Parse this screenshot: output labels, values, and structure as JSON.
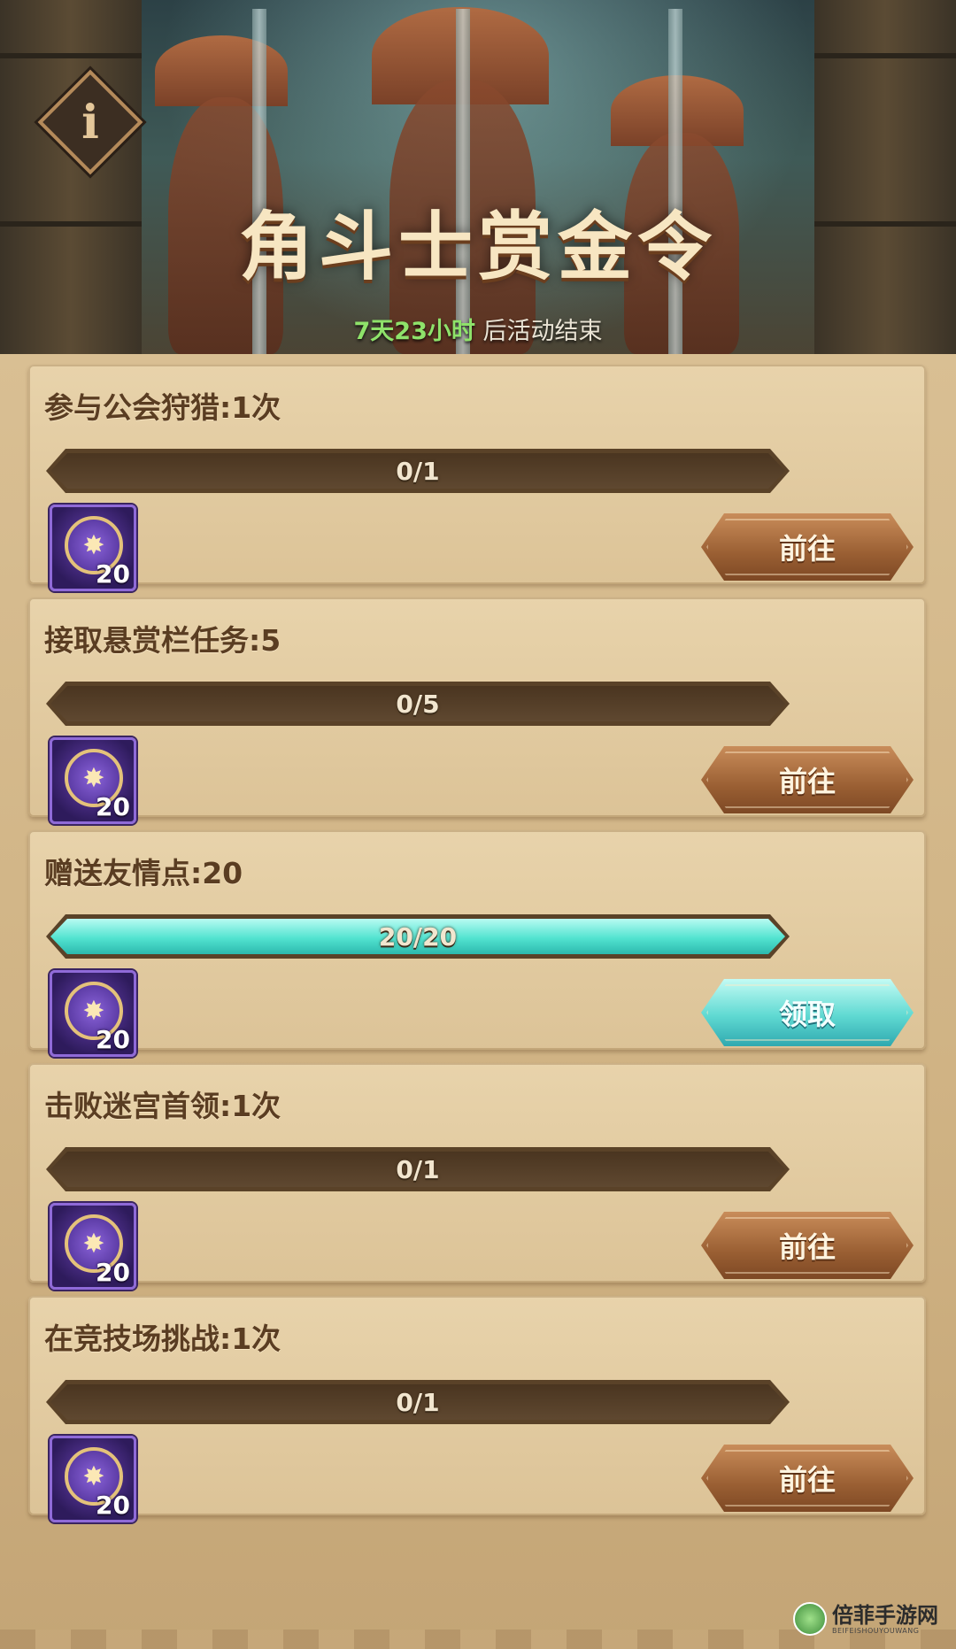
{
  "banner": {
    "title": "角斗士赏金令",
    "timer_value": "7天23小时",
    "timer_suffix": " 后活动结束"
  },
  "info_button": {
    "glyph": "i",
    "icon": "info-icon"
  },
  "tasks": [
    {
      "title": "参与公会狩猎:1次",
      "progress_text": "0/1",
      "progress": 0,
      "reward_icon": "bounty-token-icon",
      "reward_count": "20",
      "button_label": "前往",
      "button_state": "go"
    },
    {
      "title": "接取悬赏栏任务:5",
      "progress_text": "0/5",
      "progress": 0,
      "reward_icon": "bounty-token-icon",
      "reward_count": "20",
      "button_label": "前往",
      "button_state": "go"
    },
    {
      "title": "赠送友情点:20",
      "progress_text": "20/20",
      "progress": 1,
      "reward_icon": "bounty-token-icon",
      "reward_count": "20",
      "button_label": "领取",
      "button_state": "claim"
    },
    {
      "title": "击败迷宫首领:1次",
      "progress_text": "0/1",
      "progress": 0,
      "reward_icon": "bounty-token-icon",
      "reward_count": "20",
      "button_label": "前往",
      "button_state": "go"
    },
    {
      "title": "在竞技场挑战:1次",
      "progress_text": "0/1",
      "progress": 0,
      "reward_icon": "bounty-token-icon",
      "reward_count": "20",
      "button_label": "前往",
      "button_state": "go"
    }
  ],
  "watermark": {
    "name": "倍菲手游网",
    "domain": "BEIFEISHOUYOUWANG"
  },
  "colors": {
    "timer_green": "#8ee26a",
    "progress_complete": "#52e3d0",
    "button_go": "#9a5f33",
    "button_claim": "#5fd9d2",
    "reward_purple": "#6b43b5"
  }
}
